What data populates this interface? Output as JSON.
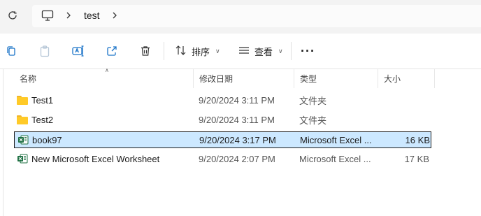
{
  "address_bar": {
    "refresh_icon": "refresh-icon",
    "location_icon": "monitor-icon",
    "breadcrumb": "test"
  },
  "toolbar": {
    "icons": [
      "copy-icon",
      "paste-icon",
      "rename-icon",
      "share-icon",
      "delete-icon"
    ],
    "sort_label": "排序",
    "view_label": "查看",
    "more_label": "···"
  },
  "columns": {
    "name": "名称",
    "modified": "修改日期",
    "type": "类型",
    "size": "大小"
  },
  "files": [
    {
      "name": "Test1",
      "modified": "9/20/2024 3:11 PM",
      "type": "文件夹",
      "size": "",
      "icon": "folder-icon",
      "selected": false
    },
    {
      "name": "Test2",
      "modified": "9/20/2024 3:11 PM",
      "type": "文件夹",
      "size": "",
      "icon": "folder-icon",
      "selected": false
    },
    {
      "name": "book97",
      "modified": "9/20/2024 3:17 PM",
      "type": "Microsoft Excel ...",
      "size": "16 KB",
      "icon": "excel-file-icon",
      "selected": true
    },
    {
      "name": "New Microsoft Excel Worksheet",
      "modified": "9/20/2024 2:07 PM",
      "type": "Microsoft Excel ...",
      "size": "17 KB",
      "icon": "excel-file-icon",
      "selected": false
    }
  ],
  "colors": {
    "selection_bg": "#cce8ff",
    "folder": "#ffca28",
    "excel_green": "#1d6f42"
  }
}
